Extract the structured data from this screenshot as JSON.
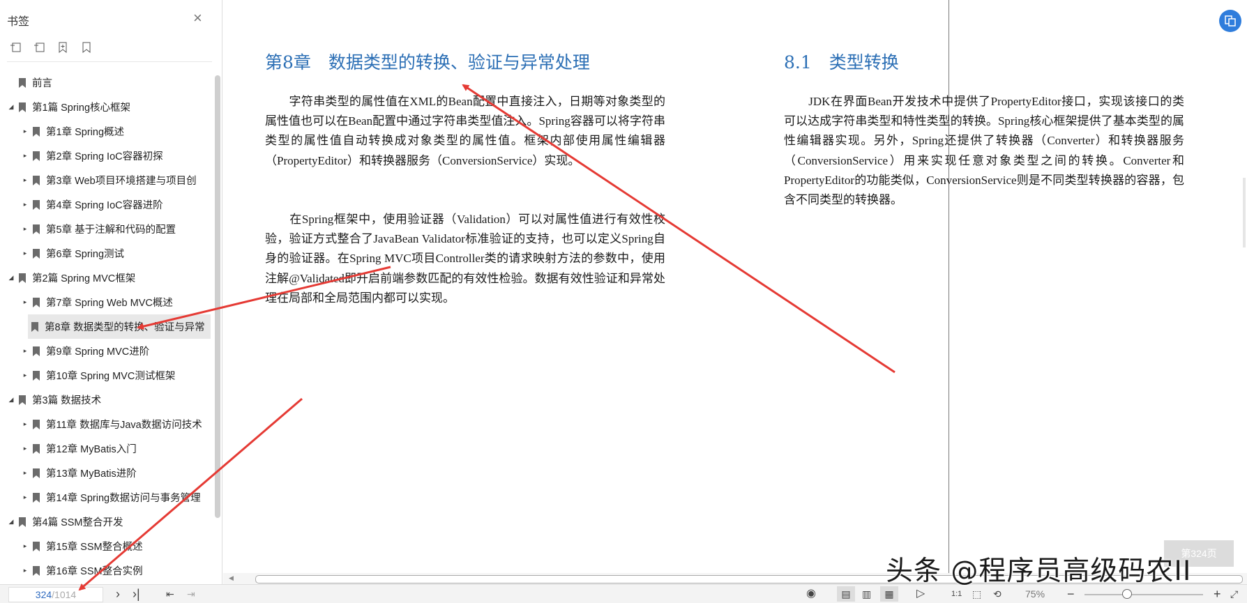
{
  "sidebar": {
    "title": "书签",
    "close": "×",
    "items": [
      {
        "label": "前言",
        "level": 0,
        "expander": ""
      },
      {
        "label": "第1篇 Spring核心框架",
        "level": 0,
        "expander": "◢"
      },
      {
        "label": "第1章 Spring概述",
        "level": 1,
        "expander": "▸"
      },
      {
        "label": "第2章 Spring IoC容器初探",
        "level": 1,
        "expander": "▸"
      },
      {
        "label": "第3章 Web项目环境搭建与项目创",
        "level": 1,
        "expander": "▸"
      },
      {
        "label": "第4章 Spring IoC容器进阶",
        "level": 1,
        "expander": "▸"
      },
      {
        "label": "第5章 基于注解和代码的配置",
        "level": 1,
        "expander": "▸"
      },
      {
        "label": "第6章 Spring测试",
        "level": 1,
        "expander": "▸"
      },
      {
        "label": "第2篇 Spring MVC框架",
        "level": 0,
        "expander": "◢"
      },
      {
        "label": "第7章 Spring Web MVC概述",
        "level": 1,
        "expander": "▸"
      },
      {
        "label": "第8章 数据类型的转换、验证与异常",
        "level": 1,
        "expander": "▸",
        "selected": true
      },
      {
        "label": "第9章 Spring MVC进阶",
        "level": 1,
        "expander": "▸"
      },
      {
        "label": "第10章 Spring MVC测试框架",
        "level": 1,
        "expander": "▸"
      },
      {
        "label": "第3篇 数据技术",
        "level": 0,
        "expander": "◢"
      },
      {
        "label": "第11章 数据库与Java数据访问技术",
        "level": 1,
        "expander": "▸"
      },
      {
        "label": "第12章 MyBatis入门",
        "level": 1,
        "expander": "▸"
      },
      {
        "label": "第13章 MyBatis进阶",
        "level": 1,
        "expander": "▸"
      },
      {
        "label": "第14章 Spring数据访问与事务管理",
        "level": 1,
        "expander": "▸"
      },
      {
        "label": "第4篇 SSM整合开发",
        "level": 0,
        "expander": "◢"
      },
      {
        "label": "第15章 SSM整合概述",
        "level": 1,
        "expander": "▸"
      },
      {
        "label": "第16章 SSM整合实例",
        "level": 1,
        "expander": "▸"
      }
    ]
  },
  "left_page": {
    "heading": "第8章　数据类型的转换、验证与异常处理",
    "para1": "　　字符串类型的属性值在XML的Bean配置中直接注入，日期等对象类型的属性值也可以在Bean配置中通过字符串类型值注入。Spring容器可以将字符串类型的属性值自动转换成对象类型的属性值。框架内部使用属性编辑器（PropertyEditor）和转换器服务（ConversionService）实现。",
    "para2": "　　在Spring框架中，使用验证器（Validation）可以对属性值进行有效性校验，验证方式整合了JavaBean Validator标准验证的支持，也可以定义Spring自身的验证器。在Spring MVC项目Controller类的请求映射方法的参数中，使用注解@Validated即开启前端参数匹配的有效性检验。数据有效性验证和异常处理在局部和全局范围内都可以实现。"
  },
  "right_page": {
    "heading": "8.1　类型转换",
    "para1": "　　JDK在界面Bean开发技术中提供了PropertyEditor接口，实现该接口的类可以达成字符串类型和特性类型的转换。Spring核心框架提供了基本类型的属性编辑器实现。另外，Spring还提供了转换器（Converter）和转换器服务（ConversionService）用来实现任意对象类型之间的转换。Converter和PropertyEditor的功能类似，ConversionService则是不同类型转换器的容器，包含不同类型的转换器。"
  },
  "page_badge": "第324页",
  "status": {
    "current_page": "324",
    "total_pages": "/1014",
    "zoom": "75%",
    "zoom_level_fraction": 0.35
  },
  "watermark": "头条 @程序员高级码农II",
  "colors": {
    "heading": "#2c6fb5",
    "arrow": "#e53a34",
    "accent": "#2f7ddc"
  }
}
